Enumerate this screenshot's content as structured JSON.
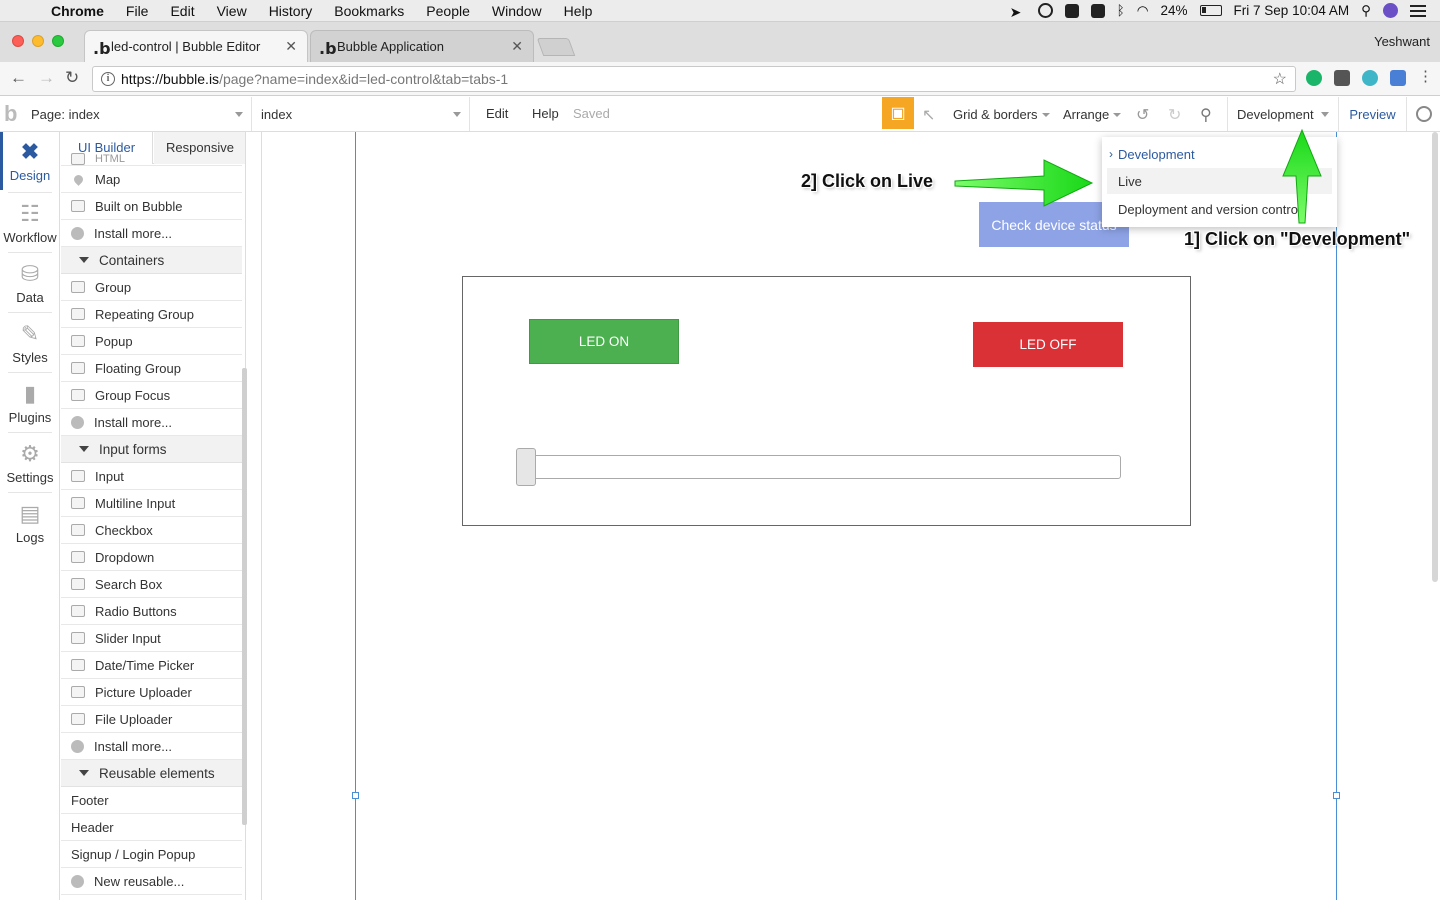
{
  "menubar": {
    "app": "Chrome",
    "items": [
      "File",
      "Edit",
      "View",
      "History",
      "Bookmarks",
      "People",
      "Window",
      "Help"
    ],
    "battery": "24%",
    "datetime": "Fri 7 Sep  10:04 AM"
  },
  "browser": {
    "tabs": [
      {
        "title": "led-control | Bubble Editor",
        "favicon": ".b"
      },
      {
        "title": "Bubble Application",
        "favicon": ".b"
      }
    ],
    "profile": "Yeshwant",
    "url_host": "https://bubble.is",
    "url_path": "/page?name=index&id=led-control&tab=tabs-1"
  },
  "toolbar": {
    "logo": "b",
    "page_select": "Page: index",
    "element_select": "index",
    "edit": "Edit",
    "help": "Help",
    "saved": "Saved",
    "grid": "Grid & borders",
    "arrange": "Arrange",
    "version": "Development",
    "preview": "Preview"
  },
  "leftnav": [
    "Design",
    "Workflow",
    "Data",
    "Styles",
    "Plugins",
    "Settings",
    "Logs"
  ],
  "palette": {
    "tabs": [
      "UI Builder",
      "Responsive"
    ],
    "partial_top": "HTML",
    "rows": [
      {
        "type": "item",
        "label": "Map",
        "icon": "pin"
      },
      {
        "type": "item",
        "label": "Built on Bubble",
        "icon": "bubble-logo"
      },
      {
        "type": "item",
        "label": "Install more...",
        "icon": "plus-circle"
      },
      {
        "type": "section",
        "label": "Containers"
      },
      {
        "type": "item",
        "label": "Group",
        "icon": "folder"
      },
      {
        "type": "item",
        "label": "Repeating Group",
        "icon": "folder-stack"
      },
      {
        "type": "item",
        "label": "Popup",
        "icon": "window"
      },
      {
        "type": "item",
        "label": "Floating Group",
        "icon": "folder"
      },
      {
        "type": "item",
        "label": "Group Focus",
        "icon": "folder-pointer"
      },
      {
        "type": "item",
        "label": "Install more...",
        "icon": "plus-circle"
      },
      {
        "type": "section",
        "label": "Input forms"
      },
      {
        "type": "item",
        "label": "Input",
        "icon": "input"
      },
      {
        "type": "item",
        "label": "Multiline Input",
        "icon": "multiline"
      },
      {
        "type": "item",
        "label": "Checkbox",
        "icon": "checkbox"
      },
      {
        "type": "item",
        "label": "Dropdown",
        "icon": "dropdown"
      },
      {
        "type": "item",
        "label": "Search Box",
        "icon": "magnifier"
      },
      {
        "type": "item",
        "label": "Radio Buttons",
        "icon": "radio"
      },
      {
        "type": "item",
        "label": "Slider Input",
        "icon": "slider"
      },
      {
        "type": "item",
        "label": "Date/Time Picker",
        "icon": "clock"
      },
      {
        "type": "item",
        "label": "Picture Uploader",
        "icon": "picture"
      },
      {
        "type": "item",
        "label": "File Uploader",
        "icon": "file"
      },
      {
        "type": "item",
        "label": "Install more...",
        "icon": "plus-circle"
      },
      {
        "type": "section",
        "label": "Reusable elements"
      },
      {
        "type": "plain",
        "label": "Footer"
      },
      {
        "type": "plain",
        "label": "Header"
      },
      {
        "type": "plain",
        "label": "Signup / Login Popup"
      },
      {
        "type": "item",
        "label": "New reusable...",
        "icon": "plus-circle"
      }
    ]
  },
  "canvas": {
    "check_button": "Check device status",
    "led_on": "LED ON",
    "led_off": "LED OFF",
    "slider_value": 0
  },
  "version_menu": {
    "options": [
      "Development",
      "Live",
      "Deployment and version control"
    ],
    "selected": "Development",
    "hovered": "Live"
  },
  "annotations": {
    "step1": "1] Click on \"Development\"",
    "step2": "2] Click on Live",
    "arrow_color": "#22e022"
  },
  "colors": {
    "accent": "#2c5aa0",
    "led_on": "#4caf50",
    "led_off": "#d93136",
    "check_button": "#8da3e6",
    "gift": "#f5a623"
  }
}
